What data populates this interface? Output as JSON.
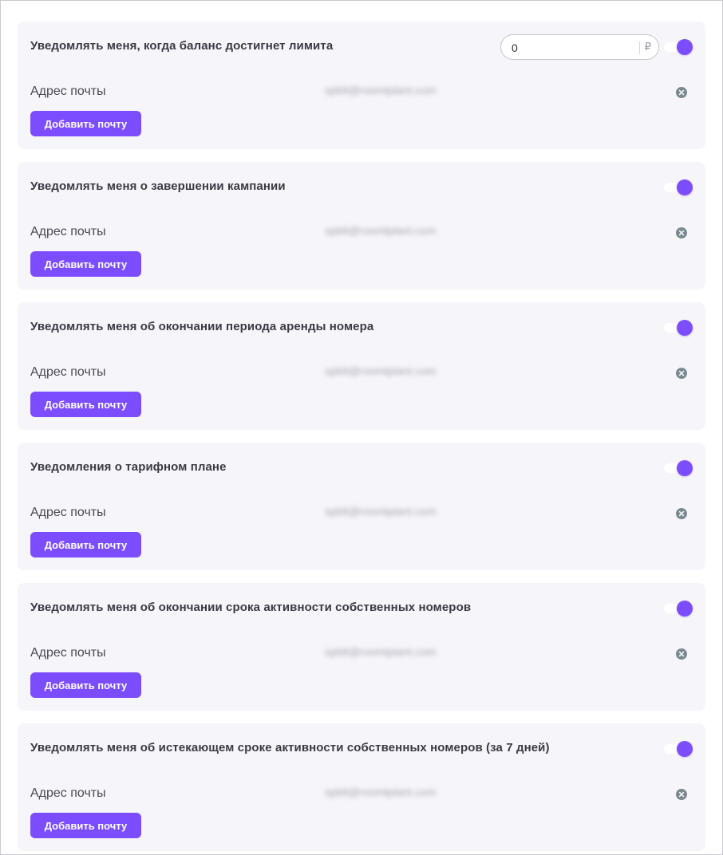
{
  "limit": {
    "value": "0",
    "currency_icon": "ruble-sign"
  },
  "cards": [
    {
      "title": "Уведомлять меня, когда баланс достигнет лимита",
      "email_label": "Адрес почты",
      "email_value": "spblt@rosmtplant.com",
      "add_label": "Добавить почту"
    },
    {
      "title": "Уведомлять меня о завершении кампании",
      "email_label": "Адрес почты",
      "email_value": "spblt@rosmtplant.com",
      "add_label": "Добавить почту"
    },
    {
      "title": "Уведомлять меня об окончании периода аренды номера",
      "email_label": "Адрес почты",
      "email_value": "spblt@rosmtplant.com",
      "add_label": "Добавить почту"
    },
    {
      "title": "Уведомления о тарифном плане",
      "email_label": "Адрес почты",
      "email_value": "spblt@rosmtplant.com",
      "add_label": "Добавить почту"
    },
    {
      "title": "Уведомлять меня об окончании срока активности собственных номеров",
      "email_label": "Адрес почты",
      "email_value": "spblt@rosmtplant.com",
      "add_label": "Добавить почту"
    },
    {
      "title": "Уведомлять меня об истекающем сроке активности собственных номеров (за 7 дней)",
      "email_label": "Адрес почты",
      "email_value": "spblt@rosmtplant.com",
      "add_label": "Добавить почту"
    }
  ],
  "colors": {
    "accent": "#7c4dff",
    "card_bg": "#f6f5fa",
    "remove_icon": "#7a8a90"
  },
  "icons": {
    "toggle": "toggle-switch-on",
    "remove": "close-circle-icon"
  }
}
